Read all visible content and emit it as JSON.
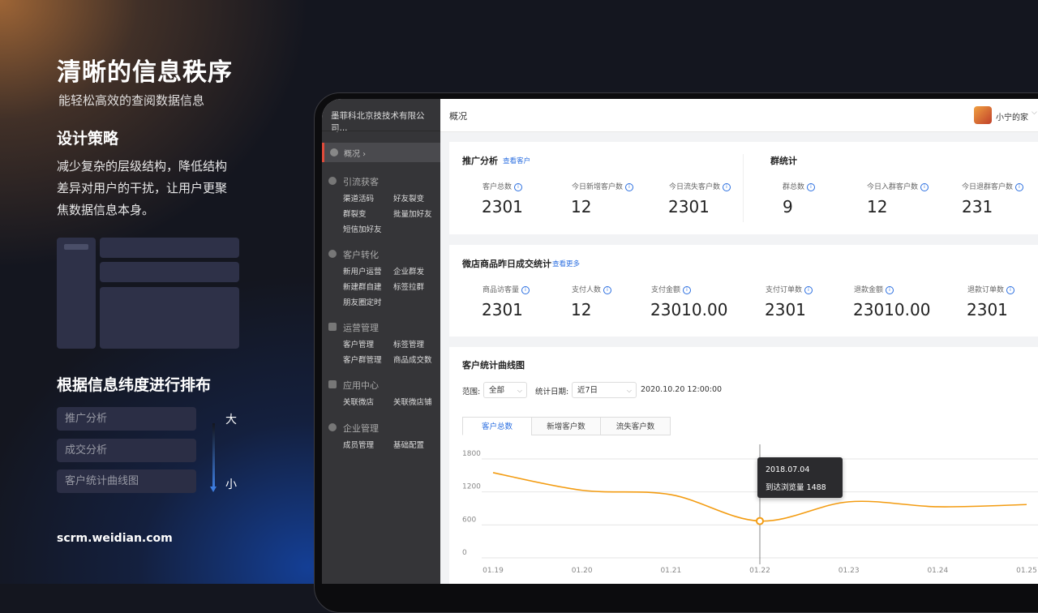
{
  "left": {
    "headline": "清晰的信息秩序",
    "subtitle": "能轻松高效的查阅数据信息",
    "strategy_title": "设计策略",
    "strategy_text": "减少复杂的层级结构，降低结构差异对用户的干扰，让用户更聚焦数据信息本身。",
    "layout_title": "根据信息纬度进行排布",
    "dimensions": [
      "推广分析",
      "成交分析",
      "客户统计曲线图"
    ],
    "scale_big": "大",
    "scale_small": "小",
    "url": "scrm.weidian.com"
  },
  "sidebar": {
    "company": "墨菲科北京技技术有限公司...",
    "overview": "概况 ›",
    "groups": [
      {
        "title": "引流获客",
        "items": [
          "渠道活码",
          "好友裂变",
          "群裂变",
          "批量加好友",
          "短信加好友"
        ]
      },
      {
        "title": "客户转化",
        "items": [
          "新用户运营",
          "企业群发",
          "新建群自建",
          "标签拉群",
          "朋友圈定时"
        ]
      },
      {
        "title": "运营管理",
        "items": [
          "客户管理",
          "标签管理",
          "客户群管理",
          "商品成交数"
        ]
      },
      {
        "title": "应用中心",
        "items": [
          "关联微店",
          "关联微店铺"
        ]
      },
      {
        "title": "企业管理",
        "items": [
          "成员管理",
          "基础配置"
        ]
      }
    ]
  },
  "topbar": {
    "title": "概况",
    "user": "小宁的家",
    "chevron": "⌵"
  },
  "promo": {
    "title": "推广分析",
    "link": "查看客户",
    "stats": [
      {
        "label": "客户总数",
        "value": "2301"
      },
      {
        "label": "今日新增客户数",
        "value": "12"
      },
      {
        "label": "今日流失客户数",
        "value": "2301"
      }
    ],
    "group_title": "群统计",
    "group_stats": [
      {
        "label": "群总数",
        "value": "9"
      },
      {
        "label": "今日入群客户数",
        "value": "12"
      },
      {
        "label": "今日退群客户数",
        "value": "231"
      }
    ]
  },
  "sales": {
    "title": "微店商品昨日成交统计",
    "link": "查看更多",
    "stats": [
      {
        "label": "商品访客量",
        "value": "2301"
      },
      {
        "label": "支付人数",
        "value": "12"
      },
      {
        "label": "支付金额",
        "value": "23010.00"
      },
      {
        "label": "支付订单数",
        "value": "2301"
      },
      {
        "label": "退款金额",
        "value": "23010.00"
      },
      {
        "label": "退款订单数",
        "value": "2301"
      }
    ]
  },
  "curve": {
    "title": "客户统计曲线图",
    "range_label": "范围:",
    "range_value": "全部",
    "date_label": "统计日期:",
    "date_value": "近7日",
    "timestamp": "2020.10.20 12:00:00",
    "tabs": [
      "客户总数",
      "新增客户数",
      "流失客户数"
    ],
    "tooltip_date": "2018.07.04",
    "tooltip_value": "到达浏览量 1488"
  },
  "colors": {
    "accent": "#2a6ee0",
    "line": "#f39c12",
    "sidebar": "#353538"
  },
  "chart_data": {
    "type": "line",
    "x": [
      "01.19",
      "01.20",
      "01.21",
      "01.22",
      "01.23",
      "01.24",
      "01.25"
    ],
    "series": [
      {
        "values": [
          1550,
          1230,
          1150,
          670,
          1020,
          930,
          970
        ]
      }
    ],
    "yticks": [
      "1800",
      "1200",
      "600",
      "0"
    ],
    "ylim": [
      0,
      1800
    ],
    "grid": true,
    "highlight_index": 3
  }
}
